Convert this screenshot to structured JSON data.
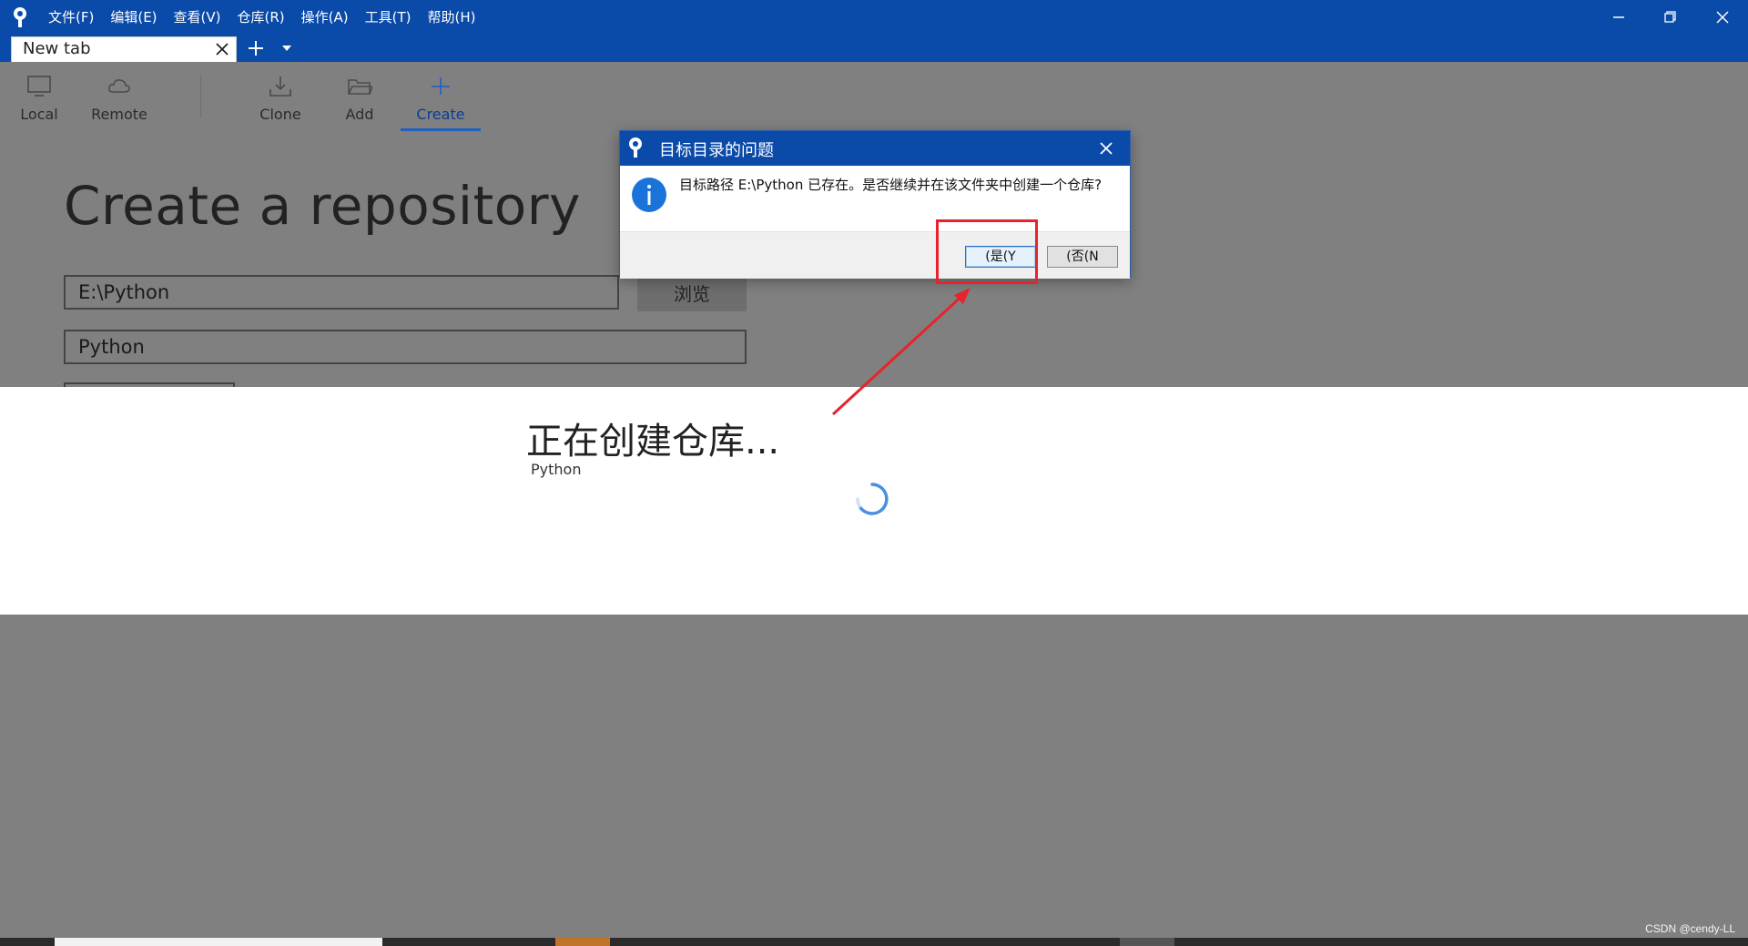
{
  "app": {
    "menu": [
      "文件(F)",
      "编辑(E)",
      "查看(V)",
      "仓库(R)",
      "操作(A)",
      "工具(T)",
      "帮助(H)"
    ],
    "window_controls": [
      "minimize-icon",
      "restore-icon",
      "close-icon"
    ],
    "brand_color": "#0a4aa8"
  },
  "tabs": {
    "active_label": "New tab"
  },
  "toolbar": {
    "items": [
      {
        "label": "Local",
        "icon": "monitor-icon"
      },
      {
        "label": "Remote",
        "icon": "cloud-icon"
      },
      {
        "label": "Clone",
        "icon": "download-icon"
      },
      {
        "label": "Add",
        "icon": "folder-icon"
      },
      {
        "label": "Create",
        "icon": "plus-icon",
        "active": true
      }
    ]
  },
  "create_page": {
    "title": "Create a repository",
    "path_value": "E:\\Python",
    "browse_label": "浏览",
    "name_value": "Python"
  },
  "progress": {
    "title": "正在创建仓库...",
    "subtitle": "Python"
  },
  "dialog": {
    "title": "目标目录的问题",
    "message": "目标路径 E:\\Python 已存在。是否继续并在该文件夹中创建一个仓库?",
    "yes_label": "(是(Y",
    "no_label": "(否(N",
    "info_icon": "info-icon"
  },
  "watermark": "CSDN @cendy-LL"
}
